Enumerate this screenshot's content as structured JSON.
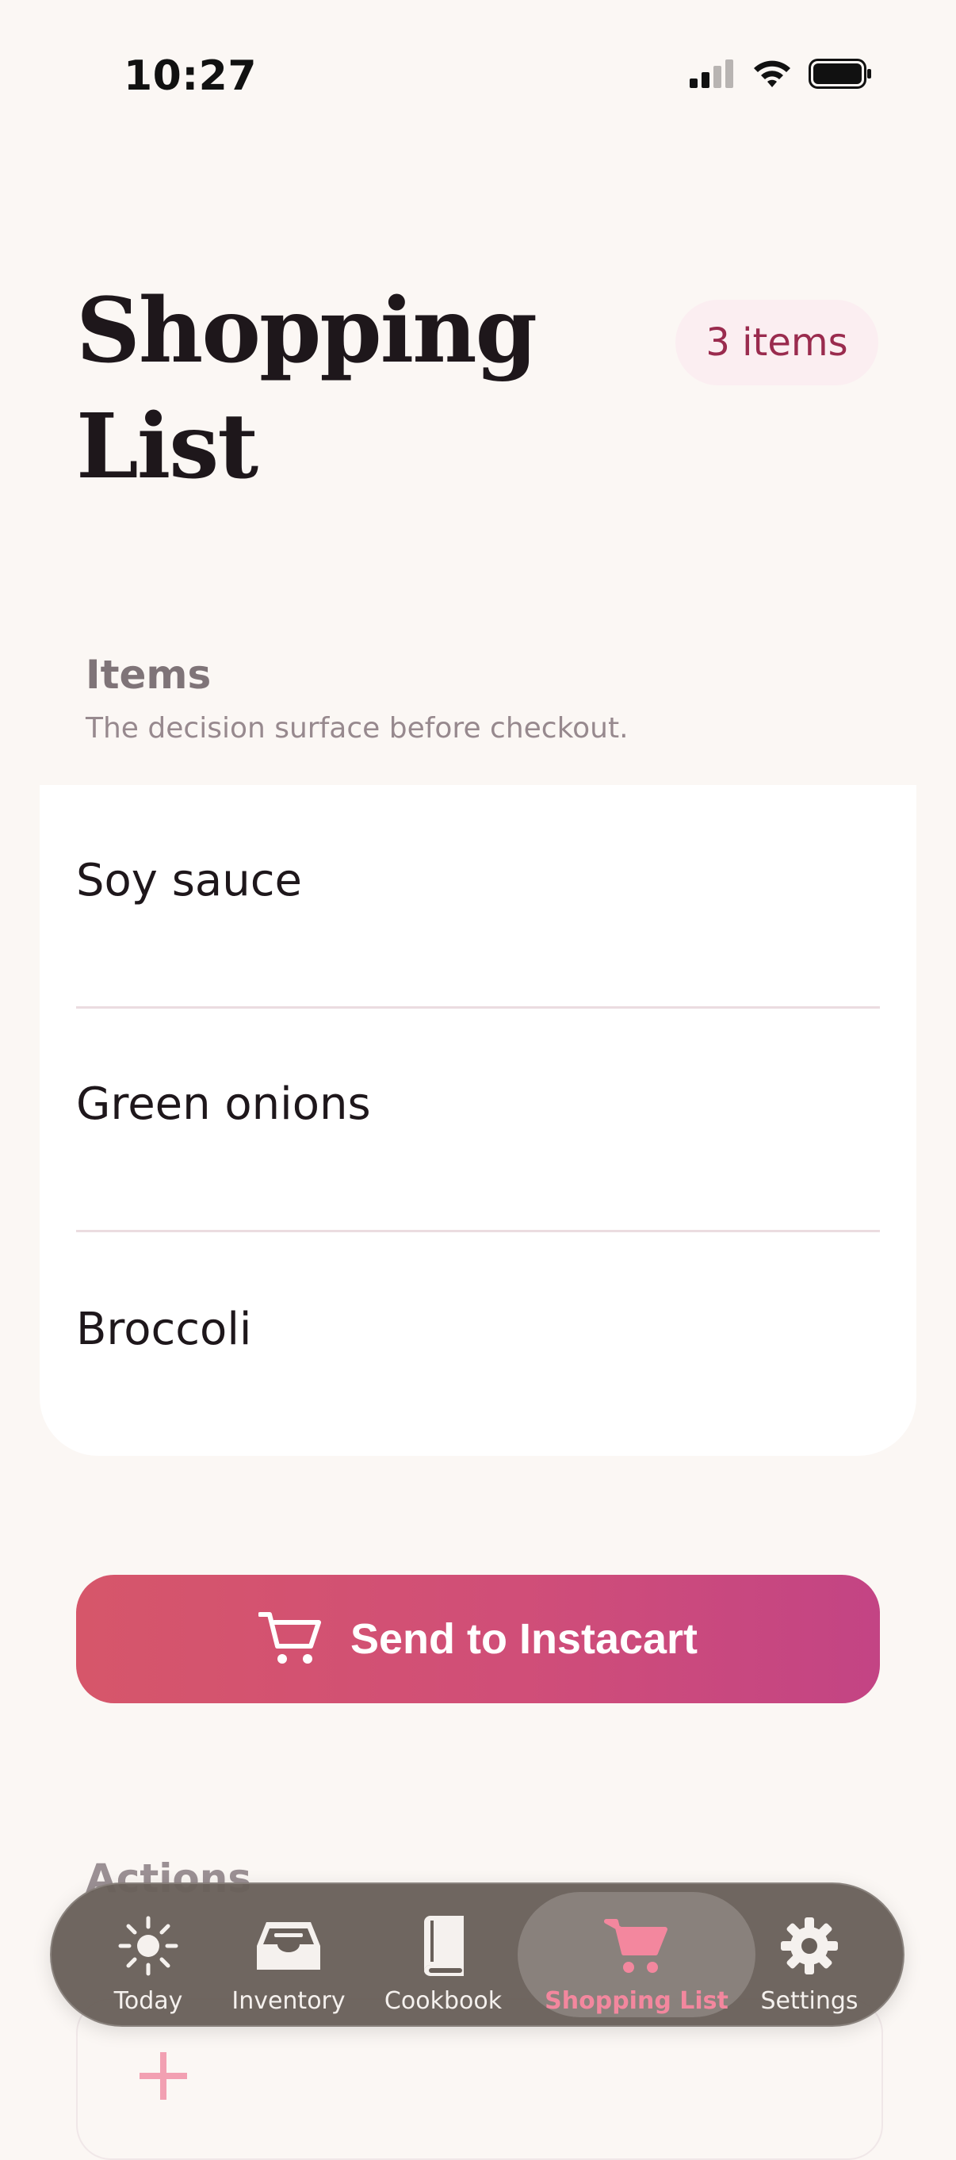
{
  "status_bar": {
    "time": "10:27"
  },
  "header": {
    "title_line1": "Shopping",
    "title_line2": "List",
    "count_badge": "3 items"
  },
  "items_section": {
    "title": "Items",
    "subtitle": "The decision surface before checkout.",
    "items": [
      {
        "label": "Soy sauce"
      },
      {
        "label": "Green onions"
      },
      {
        "label": "Broccoli"
      }
    ]
  },
  "cta": {
    "label": "Send to Instacart",
    "icon": "cart-icon"
  },
  "actions_section": {
    "title": "Actions"
  },
  "tab_bar": {
    "tabs": [
      {
        "label": "Today",
        "icon": "sun-icon"
      },
      {
        "label": "Inventory",
        "icon": "tray-icon"
      },
      {
        "label": "Cookbook",
        "icon": "book-icon"
      },
      {
        "label": "Shopping List",
        "icon": "cart-icon",
        "active": true
      },
      {
        "label": "Settings",
        "icon": "gear-icon"
      }
    ]
  },
  "colors": {
    "background": "#FBF7F4",
    "accent": "#D04E78",
    "badge_bg": "#FBEEF1",
    "badge_text": "#9A2B4E",
    "tab_active": "#F3879E"
  }
}
